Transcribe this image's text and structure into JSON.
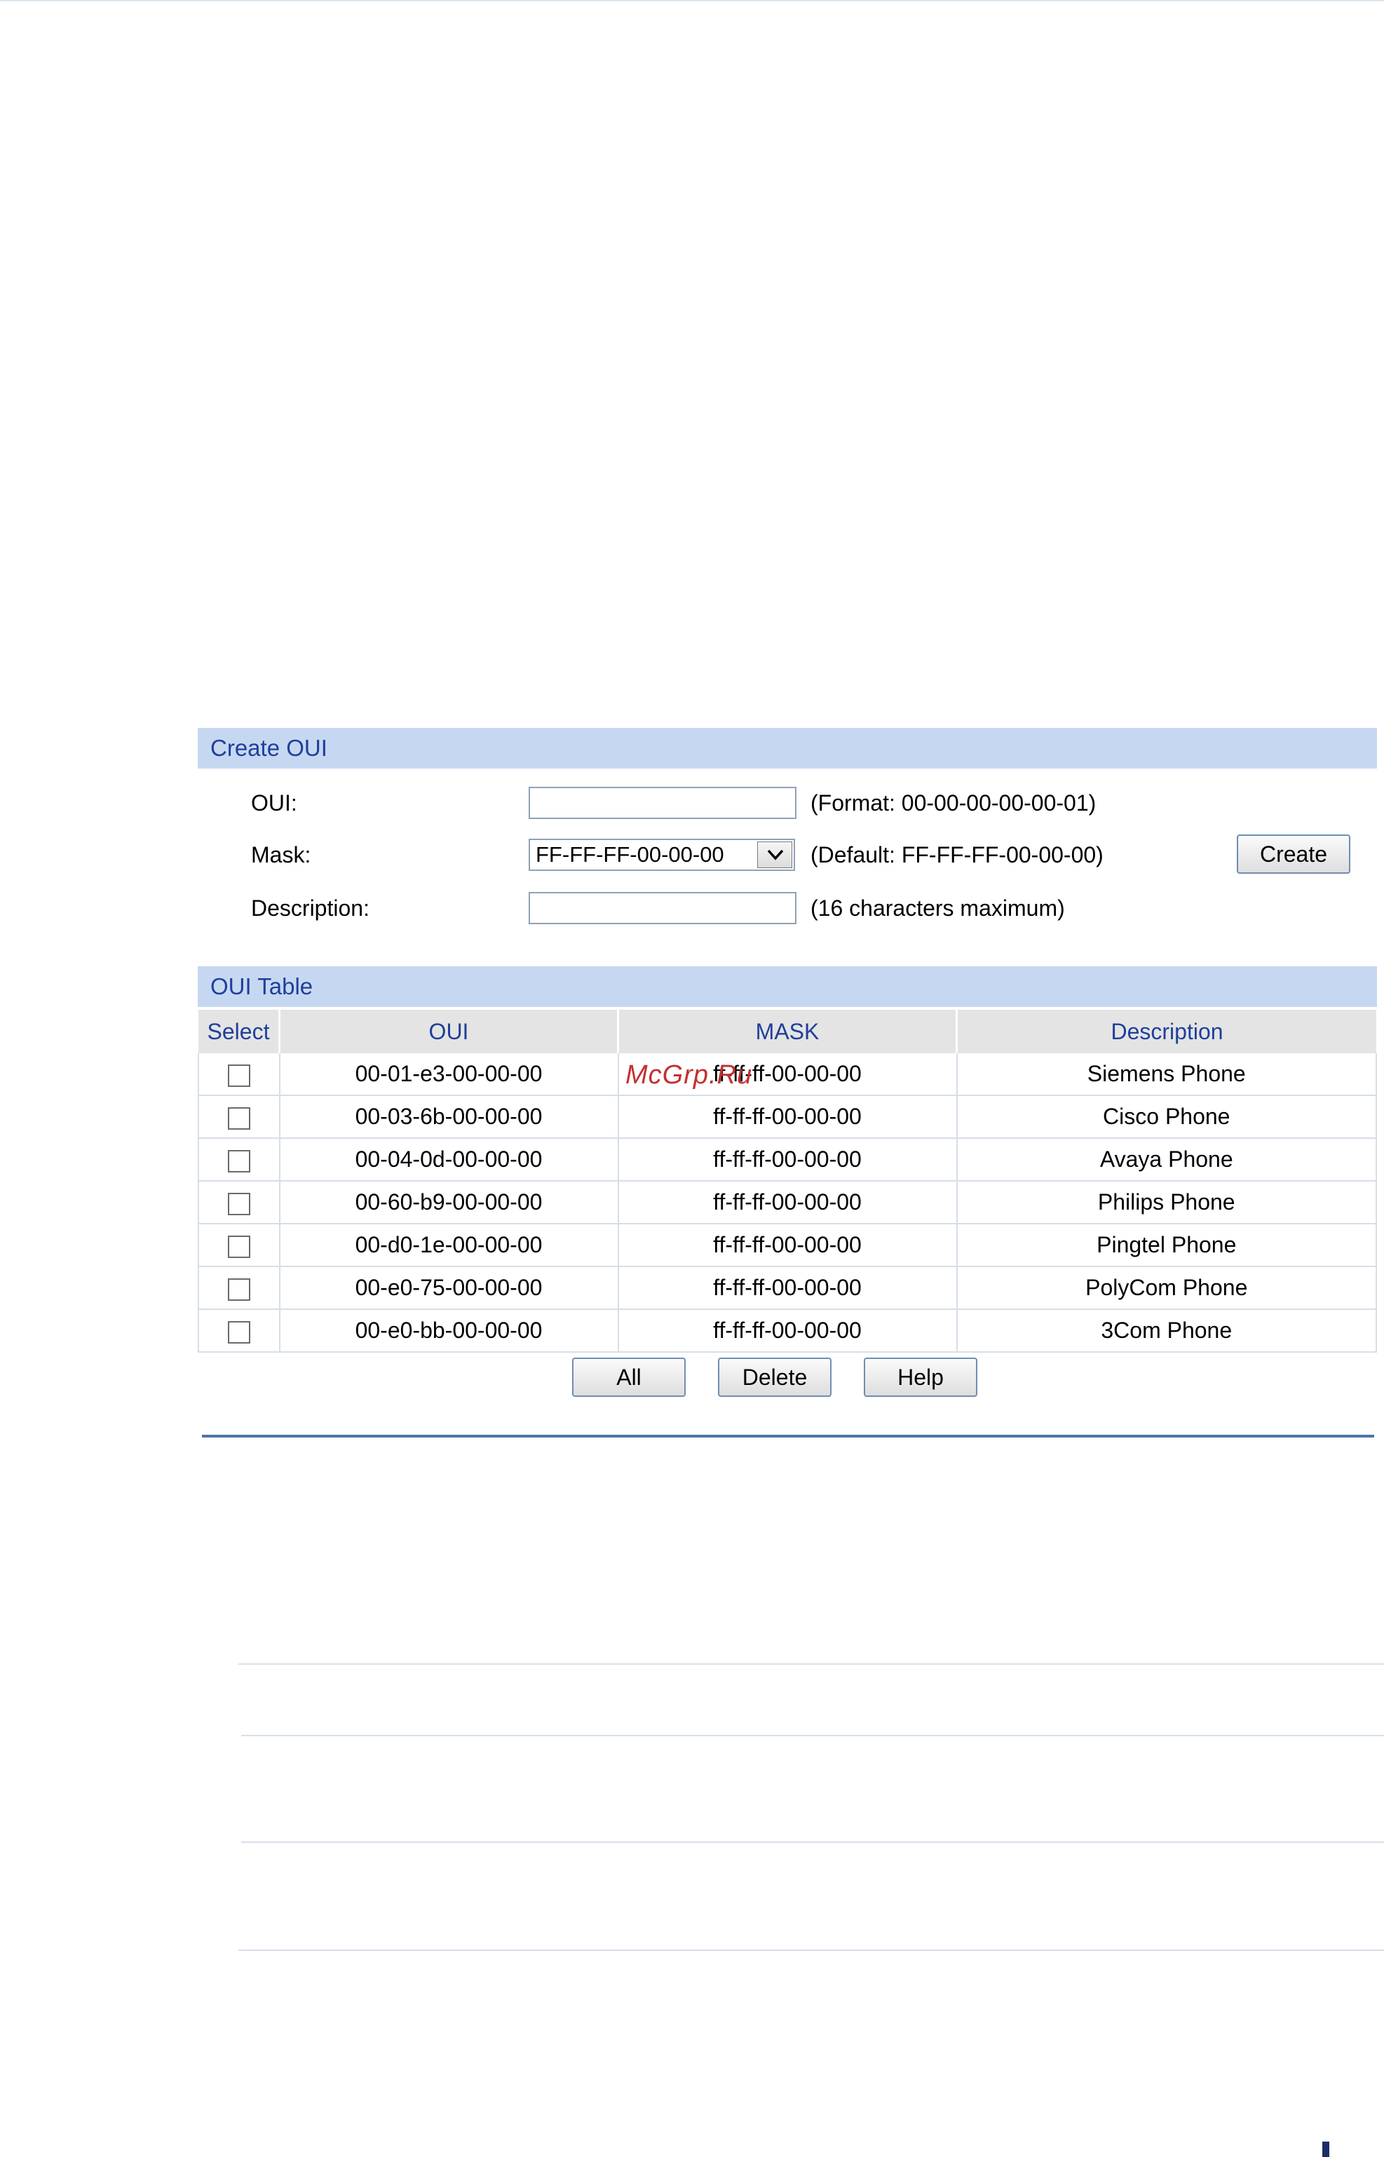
{
  "create_section": {
    "title": "Create OUI",
    "oui_label": "OUI:",
    "oui_value": "",
    "oui_hint": "(Format: 00-00-00-00-00-01)",
    "mask_label": "Mask:",
    "mask_selected": "FF-FF-FF-00-00-00",
    "mask_hint": "(Default: FF-FF-FF-00-00-00)",
    "create_button": "Create",
    "description_label": "Description:",
    "description_value": "",
    "description_hint": "(16 characters maximum)"
  },
  "table_section": {
    "title": "OUI Table",
    "columns": [
      "Select",
      "OUI",
      "MASK",
      "Description"
    ],
    "rows": [
      {
        "oui": "00-01-e3-00-00-00",
        "mask": "ff-ff-ff-00-00-00",
        "description": "Siemens Phone",
        "selected": false
      },
      {
        "oui": "00-03-6b-00-00-00",
        "mask": "ff-ff-ff-00-00-00",
        "description": "Cisco Phone",
        "selected": false
      },
      {
        "oui": "00-04-0d-00-00-00",
        "mask": "ff-ff-ff-00-00-00",
        "description": "Avaya Phone",
        "selected": false
      },
      {
        "oui": "00-60-b9-00-00-00",
        "mask": "ff-ff-ff-00-00-00",
        "description": "Philips Phone",
        "selected": false
      },
      {
        "oui": "00-d0-1e-00-00-00",
        "mask": "ff-ff-ff-00-00-00",
        "description": "Pingtel Phone",
        "selected": false
      },
      {
        "oui": "00-e0-75-00-00-00",
        "mask": "ff-ff-ff-00-00-00",
        "description": "PolyCom Phone",
        "selected": false
      },
      {
        "oui": "00-e0-bb-00-00-00",
        "mask": "ff-ff-ff-00-00-00",
        "description": "3Com Phone",
        "selected": false
      }
    ],
    "buttons": {
      "all": "All",
      "delete": "Delete",
      "help": "Help"
    }
  },
  "watermark": "McGrp.Ru",
  "icons": {
    "dropdown": "chevron-down-icon",
    "checkbox": "checkbox-icon"
  },
  "colors": {
    "section_bar": "#c6d8f1",
    "section_title": "#1f3f9a",
    "header_bg": "#e4e4e4",
    "divider": "#4d74a8"
  }
}
